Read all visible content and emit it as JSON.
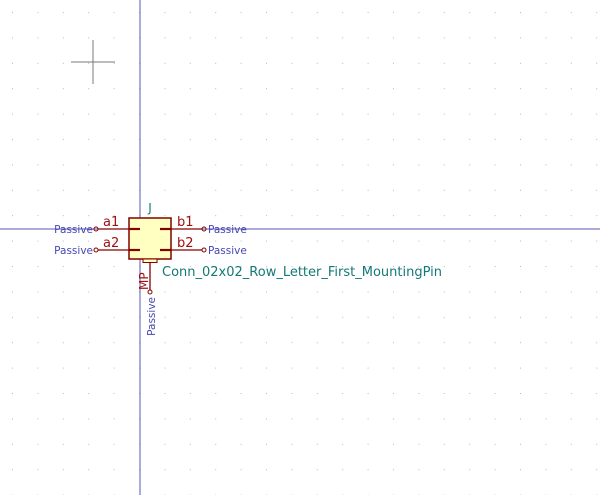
{
  "symbol": {
    "reference": "J",
    "value": "Conn_02x02_Row_Letter_First_MountingPin"
  },
  "pins": [
    {
      "id": "a1",
      "name": "a1",
      "type": "Passive"
    },
    {
      "id": "a2",
      "name": "a2",
      "type": "Passive"
    },
    {
      "id": "b1",
      "name": "b1",
      "type": "Passive"
    },
    {
      "id": "b2",
      "name": "b2",
      "type": "Passive"
    },
    {
      "id": "mp",
      "name": "MP",
      "type": "Passive"
    }
  ],
  "colors": {
    "background": "#ffffff",
    "axis": "#5a5ab4",
    "grid_dot": "#b8b8b8",
    "symbol_outline": "#840000",
    "symbol_fill": "#ffffc2",
    "pin_name": "#a01010",
    "pin_type": "#4646b4",
    "reference": "#147878",
    "value": "#147878",
    "cursor": "#7a7a7a"
  }
}
